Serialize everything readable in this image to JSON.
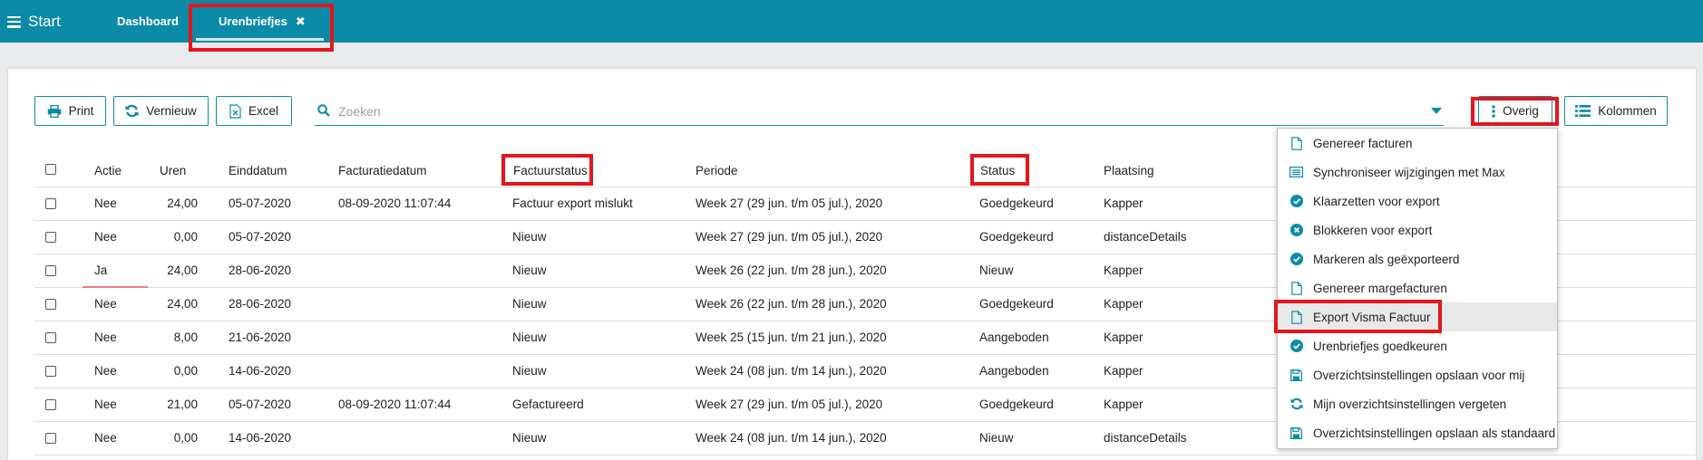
{
  "topbar": {
    "start_label": "Start",
    "tabs": [
      {
        "label": "Dashboard"
      },
      {
        "label": "Urenbriefjes",
        "close_icon": "✖"
      }
    ]
  },
  "toolbar": {
    "print_label": "Print",
    "refresh_label": "Vernieuw",
    "excel_label": "Excel",
    "search_placeholder": "Zoeken",
    "search_value": "",
    "more_label": "Overig",
    "columns_label": "Kolommen"
  },
  "table": {
    "headers": {
      "actie": "Actie",
      "uren": "Uren",
      "einddatum": "Einddatum",
      "facturatiedatum": "Facturatiedatum",
      "factuurstatus": "Factuurstatus",
      "periode": "Periode",
      "status": "Status",
      "plaatsing": "Plaatsing"
    },
    "rows": [
      {
        "actie": "Nee",
        "uren": "24,00",
        "einddatum": "05-07-2020",
        "facturatiedatum": "08-09-2020 11:07:44",
        "factuurstatus": "Factuur export mislukt",
        "periode": "Week 27 (29 jun. t/m 05 jul.), 2020",
        "status": "Goedgekeurd",
        "plaatsing": "Kapper"
      },
      {
        "actie": "Nee",
        "uren": "0,00",
        "einddatum": "05-07-2020",
        "facturatiedatum": "",
        "factuurstatus": "Nieuw",
        "periode": "Week 27 (29 jun. t/m 05 jul.), 2020",
        "status": "Goedgekeurd",
        "plaatsing": "distanceDetails"
      },
      {
        "actie": "Ja",
        "uren": "24,00",
        "einddatum": "28-06-2020",
        "facturatiedatum": "",
        "factuurstatus": "Nieuw",
        "periode": "Week 26 (22 jun. t/m 28 jun.), 2020",
        "status": "Nieuw",
        "plaatsing": "Kapper"
      },
      {
        "actie": "Nee",
        "uren": "24,00",
        "einddatum": "28-06-2020",
        "facturatiedatum": "",
        "factuurstatus": "Nieuw",
        "periode": "Week 26 (22 jun. t/m 28 jun.), 2020",
        "status": "Goedgekeurd",
        "plaatsing": "Kapper"
      },
      {
        "actie": "Nee",
        "uren": "8,00",
        "einddatum": "21-06-2020",
        "facturatiedatum": "",
        "factuurstatus": "Nieuw",
        "periode": "Week 25 (15 jun. t/m 21 jun.), 2020",
        "status": "Aangeboden",
        "plaatsing": "Kapper"
      },
      {
        "actie": "Nee",
        "uren": "0,00",
        "einddatum": "14-06-2020",
        "facturatiedatum": "",
        "factuurstatus": "Nieuw",
        "periode": "Week 24 (08 jun. t/m 14 jun.), 2020",
        "status": "Aangeboden",
        "plaatsing": "Kapper"
      },
      {
        "actie": "Nee",
        "uren": "21,00",
        "einddatum": "05-07-2020",
        "facturatiedatum": "08-09-2020 11:07:44",
        "factuurstatus": "Gefactureerd",
        "periode": "Week 27 (29 jun. t/m 05 jul.), 2020",
        "status": "Goedgekeurd",
        "plaatsing": "Kapper"
      },
      {
        "actie": "Nee",
        "uren": "0,00",
        "einddatum": "14-06-2020",
        "facturatiedatum": "",
        "factuurstatus": "Nieuw",
        "periode": "Week 24 (08 jun. t/m 14 jun.), 2020",
        "status": "Nieuw",
        "plaatsing": "distanceDetails"
      }
    ]
  },
  "more_menu": {
    "items": [
      {
        "label": "Genereer facturen",
        "icon": "file-icon"
      },
      {
        "label": "Synchroniseer wijzigingen met Max",
        "icon": "list-icon"
      },
      {
        "label": "Klaarzetten voor export",
        "icon": "check-circle-icon"
      },
      {
        "label": "Blokkeren voor export",
        "icon": "x-circle-icon"
      },
      {
        "label": "Markeren als geëxporteerd",
        "icon": "check-circle-icon"
      },
      {
        "label": "Genereer margefacturen",
        "icon": "file-icon"
      },
      {
        "label": "Export Visma Factuur",
        "icon": "file-icon"
      },
      {
        "label": "Urenbriefjes goedkeuren",
        "icon": "check-circle-icon"
      },
      {
        "label": "Overzichtsinstellingen opslaan voor mij",
        "icon": "save-icon"
      },
      {
        "label": "Mijn overzichtsinstellingen vergeten",
        "icon": "refresh-icon"
      },
      {
        "label": "Overzichtsinstellingen opslaan als standaard",
        "icon": "save-icon"
      }
    ]
  },
  "colors": {
    "accent": "#0c8ba8",
    "highlight_box": "#e4161c"
  }
}
